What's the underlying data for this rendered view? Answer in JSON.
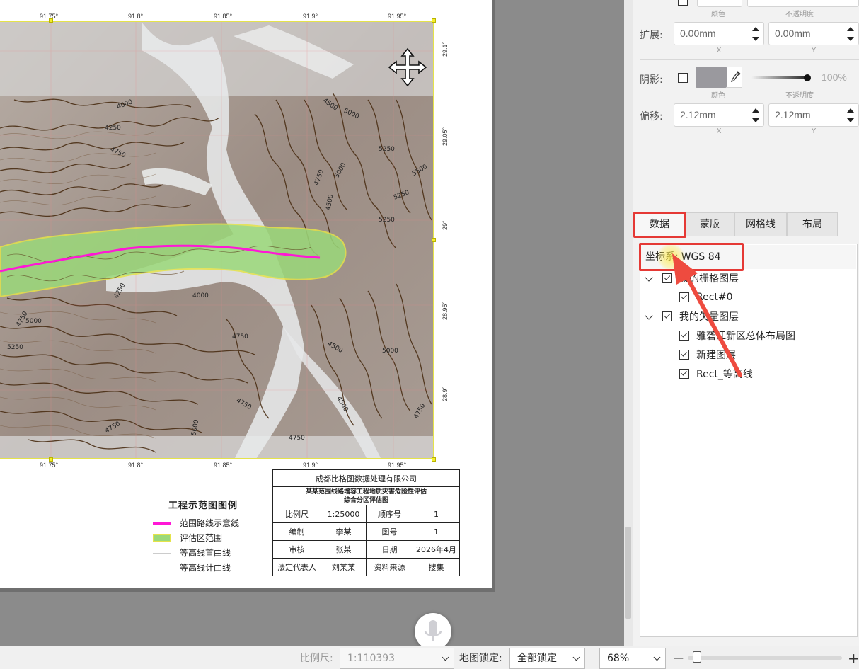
{
  "map": {
    "lon_ticks": [
      "91.75°",
      "91.8°",
      "91.85°",
      "91.9°",
      "91.95°"
    ],
    "lat_ticks": [
      "29.1°",
      "29.05°",
      "29°",
      "28.95°",
      "28.9°"
    ],
    "contour_labels": [
      "4000",
      "4250",
      "4750",
      "4500",
      "5000",
      "5250",
      "5500",
      "5000",
      "4750",
      "5250",
      "4500",
      "5250",
      "4750",
      "4250",
      "4000",
      "4750",
      "5000",
      "5250",
      "4500",
      "5000",
      "4750",
      "4500",
      "4750",
      "5000",
      "4750",
      "4750"
    ]
  },
  "legend": {
    "title": "工程示范图图例",
    "items": [
      {
        "label": "范围路线示意线"
      },
      {
        "label": "评估区范围"
      },
      {
        "label": "等高线首曲线"
      },
      {
        "label": "等高线计曲线"
      }
    ]
  },
  "title_block": {
    "company": "成都比格图数据处理有限公司",
    "map_name_1": "某某范围线路增容工程地质灾害危险性评估",
    "map_name_2": "综合分区评估图",
    "rows": [
      [
        "比例尺",
        "1:25000",
        "顺序号",
        "1"
      ],
      [
        "编制",
        "李某",
        "图号",
        "1"
      ],
      [
        "审核",
        "张某",
        "日期",
        "2026年4月"
      ],
      [
        "法定代表人",
        "刘某某",
        "资料来源",
        "搜集"
      ]
    ]
  },
  "panel": {
    "top_partial_label": "",
    "color_label": "颜色",
    "opacity_label": "不透明度",
    "extend": {
      "label": "扩展:",
      "x": "0.00mm",
      "y": "0.00mm",
      "x_label": "X",
      "y_label": "Y"
    },
    "shadow": {
      "label": "阴影:",
      "opacity": "100%",
      "opacity_value": 1.0,
      "color": "#9a999e"
    },
    "offset": {
      "label": "偏移:",
      "x": "2.12mm",
      "y": "2.12mm",
      "x_label": "X",
      "y_label": "Y"
    },
    "tabs": [
      "数据",
      "蒙版",
      "网格线",
      "布局"
    ],
    "active_tab": "数据",
    "crs": {
      "label": "坐标系:",
      "value": "WGS 84"
    },
    "layers": [
      {
        "label": "我的栅格图层",
        "level": 0,
        "expanded": true,
        "checked": true
      },
      {
        "label": "Rect#0",
        "level": 1,
        "checked": true
      },
      {
        "label": "我的矢量图层",
        "level": 0,
        "expanded": true,
        "checked": true
      },
      {
        "label": "雅砻江新区总体布局图",
        "level": 1,
        "checked": true
      },
      {
        "label": "新建图层",
        "level": 1,
        "checked": true
      },
      {
        "label": "Rect_等高线",
        "level": 1,
        "checked": true
      }
    ]
  },
  "statusbar": {
    "scale_label": "比例尺:",
    "scale_value": "1:110393",
    "lock_label": "地图锁定:",
    "lock_value": "全部锁定",
    "zoom_value": "68%",
    "zoom_minus": "—",
    "zoom_plus": "+"
  },
  "colors": {
    "route": "#ff17d6",
    "assessment_area": "#9bd97a",
    "frame_yellow": "#e5e34a",
    "highlight_red": "#e53935",
    "contour_major": "#5a3a1a"
  }
}
